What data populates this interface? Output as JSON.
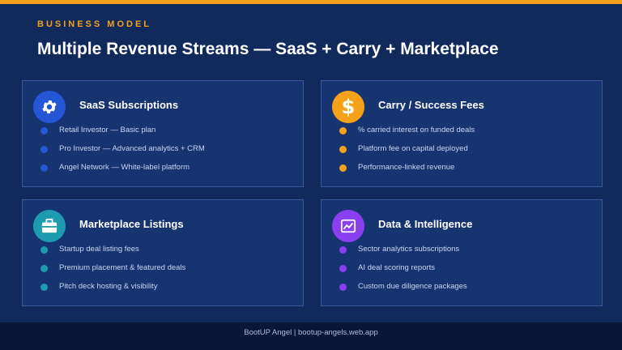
{
  "kicker": "BUSINESS MODEL",
  "title": "Multiple Revenue Streams — SaaS + Carry + Marketplace",
  "colors": {
    "accent": "#f5a21a",
    "blue": "#2456d6",
    "orange": "#f5a21a",
    "teal": "#1f9bb0",
    "purple": "#8a3ff0"
  },
  "cards": [
    {
      "title": "SaaS Subscriptions",
      "icon": "gear-icon",
      "items": [
        "Retail Investor — Basic plan",
        "Pro Investor — Advanced analytics + CRM",
        "Angel Network — White-label platform"
      ]
    },
    {
      "title": "Carry / Success Fees",
      "icon": "dollar-icon",
      "items": [
        "% carried interest on funded deals",
        "Platform fee on capital deployed",
        "Performance-linked revenue"
      ]
    },
    {
      "title": "Marketplace Listings",
      "icon": "briefcase-icon",
      "items": [
        "Startup deal listing fees",
        "Premium placement & featured deals",
        "Pitch deck hosting & visibility"
      ]
    },
    {
      "title": "Data & Intelligence",
      "icon": "chart-icon",
      "items": [
        "Sector analytics subscriptions",
        "AI deal scoring reports",
        "Custom due diligence packages"
      ]
    }
  ],
  "footer": "BootUP Angel  |  bootup-angels.web.app"
}
